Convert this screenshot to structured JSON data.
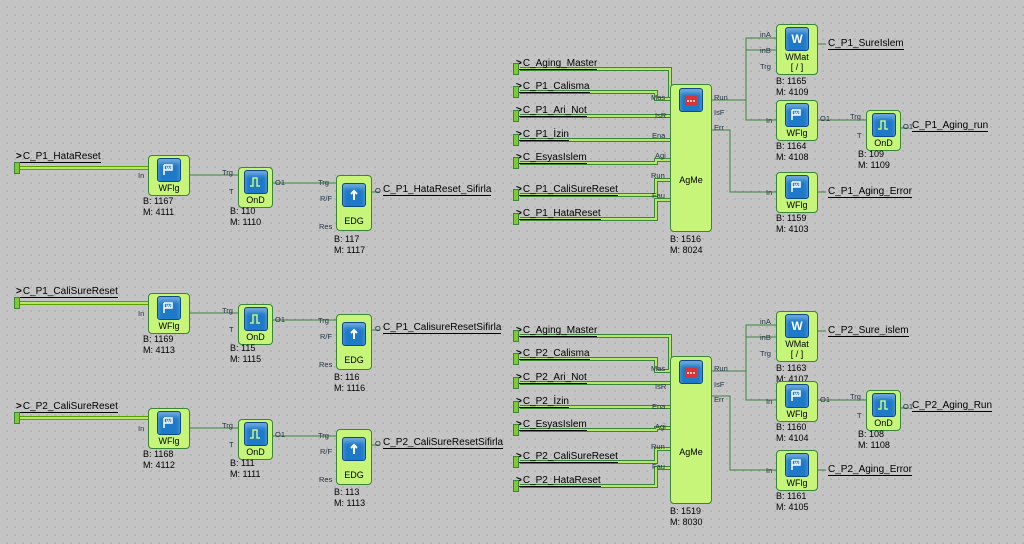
{
  "blocks": {
    "wflg1": {
      "type": "WFlg",
      "b": "B: 1167",
      "m": "M: 4111"
    },
    "ond1": {
      "type": "OnD",
      "b": "B: 110",
      "m": "M: 1110"
    },
    "edg1": {
      "type": "EDG",
      "b": "B: 117",
      "m": "M: 1117"
    },
    "wflg2": {
      "type": "WFlg",
      "b": "B: 1169",
      "m": "M: 4113"
    },
    "ond2": {
      "type": "OnD",
      "b": "B: 115",
      "m": "M: 1115"
    },
    "edg2": {
      "type": "EDG",
      "b": "B: 116",
      "m": "M: 1116"
    },
    "wflg3": {
      "type": "WFlg",
      "b": "B: 1168",
      "m": "M: 4112"
    },
    "ond3": {
      "type": "OnD",
      "b": "B: 111",
      "m": "M: 1111"
    },
    "edg3": {
      "type": "EDG",
      "b": "B: 113",
      "m": "M: 1113"
    },
    "agme1": {
      "type": "AgMe",
      "b": "B: 1516",
      "m": "M: 8024"
    },
    "wmat1": {
      "type": "WMat",
      "sub": "[ / ]",
      "b": "B: 1165",
      "m": "M: 4109"
    },
    "wflg4": {
      "type": "WFlg",
      "b": "B: 1164",
      "m": "M: 4108"
    },
    "ond4": {
      "type": "OnD",
      "b": "B: 109",
      "m": "M: 1109"
    },
    "wflg5": {
      "type": "WFlg",
      "b": "B: 1159",
      "m": "M: 4103"
    },
    "agme2": {
      "type": "AgMe",
      "b": "B: 1519",
      "m": "M: 8030"
    },
    "wmat2": {
      "type": "WMat",
      "sub": "[ / ]",
      "b": "B: 1163",
      "m": "M: 4107"
    },
    "wflg6": {
      "type": "WFlg",
      "b": "B: 1160",
      "m": "M: 4104"
    },
    "ond5": {
      "type": "OnD",
      "b": "B: 108",
      "m": "M: 1108"
    },
    "wflg7": {
      "type": "WFlg",
      "b": "B: 1161",
      "m": "M: 4105"
    }
  },
  "signals": {
    "in1": "C_P1_HataReset",
    "in2": "C_P1_CaliSureReset",
    "in3": "C_P2_CaliSureReset",
    "out1": "C_P1_HataReset_Sifirla",
    "out2": "C_P1_CalisureResetSifirla",
    "out3": "C_P2_CaliSureResetSifirla",
    "ag1_1": "C_Aging_Master",
    "ag1_2": "C_P1_Calisma",
    "ag1_3": "C_P1_Ari_Not",
    "ag1_4": "C_P1_İzin",
    "ag1_5": "C_EsyasIslem",
    "ag1_6": "C_P1_CaliSureReset",
    "ag1_7": "C_P1_HataReset",
    "o1_1": "C_P1_SureIslem",
    "o1_2": "C_P1_Aging_run",
    "o1_3": "C_P1_Aging_Error",
    "ag2_1": "C_Aging_Master",
    "ag2_2": "C_P2_Calisma",
    "ag2_3": "C_P2_Ari_Not",
    "ag2_4": "C_P2_İzin",
    "ag2_5": "C_EsyasIslem",
    "ag2_6": "C_P2_CaliSureReset",
    "ag2_7": "C_P2_HataReset",
    "o2_1": "C_P2_Sure_islem",
    "o2_2": "C_P2_Aging_Run",
    "o2_3": "C_P2_Aging_Error"
  },
  "ports": {
    "in": "In",
    "trg": "Trg",
    "t": "T",
    "o1": "O1",
    "rf": "R/F",
    "o": "O",
    "res": "Res",
    "mas": "Mas",
    "isr": "IsR",
    "ena": "Ena",
    "agi": "Agi",
    "run_l": "Run",
    "fau": "Fau",
    "run_r": "Run",
    "isf": "IsF",
    "err": "Err",
    "ina": "inA",
    "inb": "inB"
  }
}
